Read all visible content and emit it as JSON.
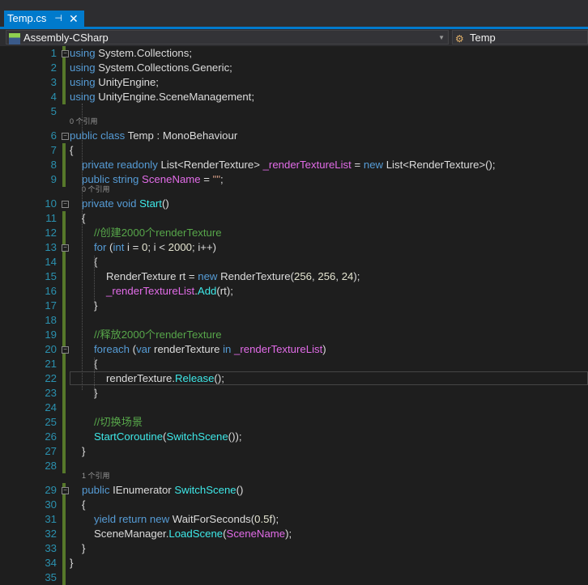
{
  "tab": {
    "title": "Temp.cs",
    "pin_icon": "⊣",
    "close_icon": "✕"
  },
  "nav": {
    "project": "Assembly-CSharp",
    "class": "Temp"
  },
  "codelens": {
    "l6": "0 个引用",
    "l10": "0 个引用",
    "l29": "1 个引用"
  },
  "lines": [
    {
      "n": "1",
      "ind": 0,
      "fold": true,
      "tok": [
        [
          "k",
          "using"
        ],
        [
          "t",
          " System.Collections;"
        ]
      ]
    },
    {
      "n": "2",
      "ind": 0,
      "tok": [
        [
          "k",
          "using"
        ],
        [
          "t",
          " System.Collections.Generic;"
        ]
      ]
    },
    {
      "n": "3",
      "ind": 0,
      "tok": [
        [
          "k",
          "using"
        ],
        [
          "t",
          " UnityEngine;"
        ]
      ]
    },
    {
      "n": "4",
      "ind": 0,
      "tok": [
        [
          "k",
          "using"
        ],
        [
          "t",
          " UnityEngine.SceneManagement;"
        ]
      ]
    },
    {
      "n": "5",
      "ind": 0,
      "tok": []
    },
    {
      "n": "6",
      "ind": 0,
      "fold": true,
      "tok": [
        [
          "k",
          "public class"
        ],
        [
          "t",
          " Temp : MonoBehaviour"
        ]
      ]
    },
    {
      "n": "7",
      "ind": 0,
      "tok": [
        [
          "t",
          "{"
        ]
      ]
    },
    {
      "n": "8",
      "ind": 1,
      "tok": [
        [
          "k",
          "private readonly"
        ],
        [
          "t",
          " List<RenderTexture> "
        ],
        [
          "f",
          "_renderTextureList"
        ],
        [
          "t",
          " = "
        ],
        [
          "k",
          "new"
        ],
        [
          "t",
          " List<RenderTexture>();"
        ]
      ]
    },
    {
      "n": "9",
      "ind": 1,
      "tok": [
        [
          "k",
          "public string"
        ],
        [
          "t",
          " "
        ],
        [
          "f",
          "SceneName"
        ],
        [
          "t",
          " = "
        ],
        [
          "s",
          "\"\""
        ],
        [
          "t",
          ";"
        ]
      ]
    },
    {
      "n": "10",
      "ind": 1,
      "fold": true,
      "tok": [
        [
          "k",
          "private void"
        ],
        [
          "t",
          " "
        ],
        [
          "m",
          "Start"
        ],
        [
          "t",
          "()"
        ]
      ]
    },
    {
      "n": "11",
      "ind": 1,
      "tok": [
        [
          "t",
          "{"
        ]
      ]
    },
    {
      "n": "12",
      "ind": 2,
      "tok": [
        [
          "c",
          "//创建2000个renderTexture"
        ]
      ]
    },
    {
      "n": "13",
      "ind": 2,
      "fold": true,
      "tok": [
        [
          "k",
          "for"
        ],
        [
          "t",
          " ("
        ],
        [
          "k",
          "int"
        ],
        [
          "t",
          " i = "
        ],
        [
          "n",
          "0"
        ],
        [
          "t",
          "; i < "
        ],
        [
          "n",
          "2000"
        ],
        [
          "t",
          "; i++)"
        ]
      ]
    },
    {
      "n": "14",
      "ind": 2,
      "tok": [
        [
          "t",
          "{"
        ]
      ]
    },
    {
      "n": "15",
      "ind": 3,
      "tok": [
        [
          "t",
          "RenderTexture rt = "
        ],
        [
          "k",
          "new"
        ],
        [
          "t",
          " RenderTexture("
        ],
        [
          "n",
          "256"
        ],
        [
          "t",
          ", "
        ],
        [
          "n",
          "256"
        ],
        [
          "t",
          ", "
        ],
        [
          "n",
          "24"
        ],
        [
          "t",
          ");"
        ]
      ]
    },
    {
      "n": "16",
      "ind": 3,
      "tok": [
        [
          "f",
          "_renderTextureList"
        ],
        [
          "t",
          "."
        ],
        [
          "m",
          "Add"
        ],
        [
          "t",
          "(rt);"
        ]
      ]
    },
    {
      "n": "17",
      "ind": 2,
      "tok": [
        [
          "t",
          "}"
        ]
      ]
    },
    {
      "n": "18",
      "ind": 0,
      "tok": []
    },
    {
      "n": "19",
      "ind": 2,
      "tok": [
        [
          "c",
          "//释放2000个renderTexture"
        ]
      ]
    },
    {
      "n": "20",
      "ind": 2,
      "fold": true,
      "tok": [
        [
          "k",
          "foreach"
        ],
        [
          "t",
          " ("
        ],
        [
          "k",
          "var"
        ],
        [
          "t",
          " renderTexture "
        ],
        [
          "k",
          "in"
        ],
        [
          "t",
          " "
        ],
        [
          "f",
          "_renderTextureList"
        ],
        [
          "t",
          ")"
        ]
      ]
    },
    {
      "n": "21",
      "ind": 2,
      "tok": [
        [
          "t",
          "{"
        ]
      ]
    },
    {
      "n": "22",
      "ind": 3,
      "cur": true,
      "tok": [
        [
          "t",
          "renderTexture."
        ],
        [
          "m",
          "Release"
        ],
        [
          "t",
          "();"
        ]
      ]
    },
    {
      "n": "23",
      "ind": 2,
      "tok": [
        [
          "t",
          "}"
        ]
      ]
    },
    {
      "n": "24",
      "ind": 0,
      "tok": []
    },
    {
      "n": "25",
      "ind": 2,
      "tok": [
        [
          "c",
          "//切换场景"
        ]
      ]
    },
    {
      "n": "26",
      "ind": 2,
      "tok": [
        [
          "m",
          "StartCoroutine"
        ],
        [
          "t",
          "("
        ],
        [
          "m",
          "SwitchScene"
        ],
        [
          "t",
          "());"
        ]
      ]
    },
    {
      "n": "27",
      "ind": 1,
      "tok": [
        [
          "t",
          "}"
        ]
      ]
    },
    {
      "n": "28",
      "ind": 0,
      "tok": []
    },
    {
      "n": "29",
      "ind": 1,
      "fold": true,
      "tok": [
        [
          "k",
          "public"
        ],
        [
          "t",
          " IEnumerator "
        ],
        [
          "m",
          "SwitchScene"
        ],
        [
          "t",
          "()"
        ]
      ]
    },
    {
      "n": "30",
      "ind": 1,
      "tok": [
        [
          "t",
          "{"
        ]
      ]
    },
    {
      "n": "31",
      "ind": 2,
      "tok": [
        [
          "k",
          "yield return new"
        ],
        [
          "t",
          " WaitForSeconds("
        ],
        [
          "n",
          "0.5f"
        ],
        [
          "t",
          ");"
        ]
      ]
    },
    {
      "n": "32",
      "ind": 2,
      "tok": [
        [
          "t",
          "SceneManager."
        ],
        [
          "m",
          "LoadScene"
        ],
        [
          "t",
          "("
        ],
        [
          "f",
          "SceneName"
        ],
        [
          "t",
          ");"
        ]
      ]
    },
    {
      "n": "33",
      "ind": 1,
      "tok": [
        [
          "t",
          "}"
        ]
      ]
    },
    {
      "n": "34",
      "ind": 0,
      "tok": [
        [
          "t",
          "}"
        ]
      ]
    },
    {
      "n": "35",
      "ind": 0,
      "tok": []
    }
  ],
  "colors": {
    "accent": "#007acc",
    "keyword": "#569cd6",
    "field": "#e26ce8",
    "method": "#3ee8e8",
    "comment": "#57a64a",
    "linenum": "#2b91af"
  }
}
